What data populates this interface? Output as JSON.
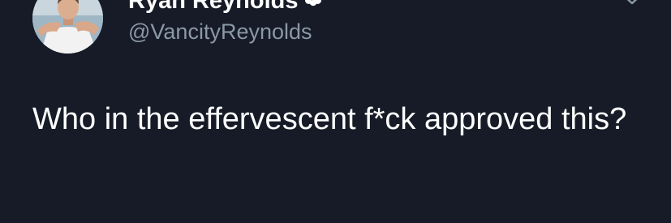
{
  "author": {
    "display_name": "Ryan Reynolds",
    "handle": "@VancityReynolds",
    "verified": true,
    "avatar_icon": "profile-photo"
  },
  "tweet": {
    "text": "Who in the effervescent f*ck approved this?"
  },
  "menu": {
    "icon": "chevron-down-icon"
  },
  "colors": {
    "background": "#161b27",
    "text": "#ffffff",
    "secondary_text": "#8b98a6"
  }
}
